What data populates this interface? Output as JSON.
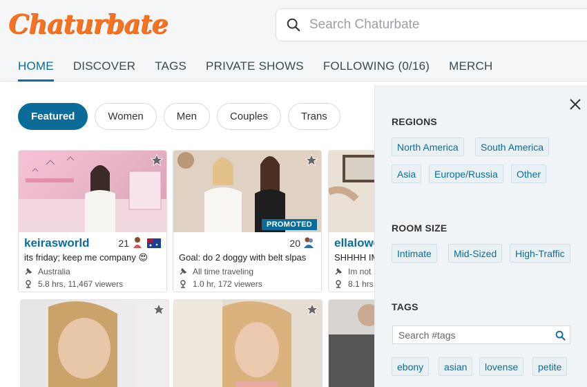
{
  "header": {
    "logo": "Chaturbate",
    "search_placeholder": "Search Chaturbate"
  },
  "nav": [
    {
      "label": "HOME",
      "active": true
    },
    {
      "label": "DISCOVER"
    },
    {
      "label": "TAGS"
    },
    {
      "label": "PRIVATE SHOWS"
    },
    {
      "label": "FOLLOWING (0/16)"
    },
    {
      "label": "MERCH"
    }
  ],
  "filters": [
    {
      "label": "Featured",
      "active": true
    },
    {
      "label": "Women"
    },
    {
      "label": "Men"
    },
    {
      "label": "Couples"
    },
    {
      "label": "Trans"
    }
  ],
  "cards": [
    {
      "username": "keirasworld",
      "age": "21",
      "subject": "its friday; keep me company 😍",
      "location": "Australia",
      "viewers": "5.8 hrs, 11,467 viewers"
    },
    {
      "username": "",
      "age": "20",
      "subject": "Goal: do 2 doggy with belt slpas",
      "location": "All time traveling",
      "viewers": "1.0 hr, 172 viewers",
      "badge": "PROMOTED"
    },
    {
      "username": "ellalowe",
      "age": "",
      "subject": "SHHHH IM",
      "location": "Im not",
      "viewers": "8.1 hrs"
    }
  ],
  "panel": {
    "regions_title": "REGIONS",
    "regions": [
      "North America",
      "South America",
      "Asia",
      "Europe/Russia",
      "Other"
    ],
    "room_size_title": "ROOM SIZE",
    "room_sizes": [
      "Intimate",
      "Mid-Sized",
      "High-Traffic"
    ],
    "tags_title": "TAGS",
    "tag_search_placeholder": "Search #tags",
    "tags": [
      "ebony",
      "asian",
      "lovense",
      "petite"
    ]
  },
  "colors": {
    "brand_orange": "#f47321",
    "accent_blue": "#0b6c99",
    "panel_bg": "#f1f4f7"
  }
}
